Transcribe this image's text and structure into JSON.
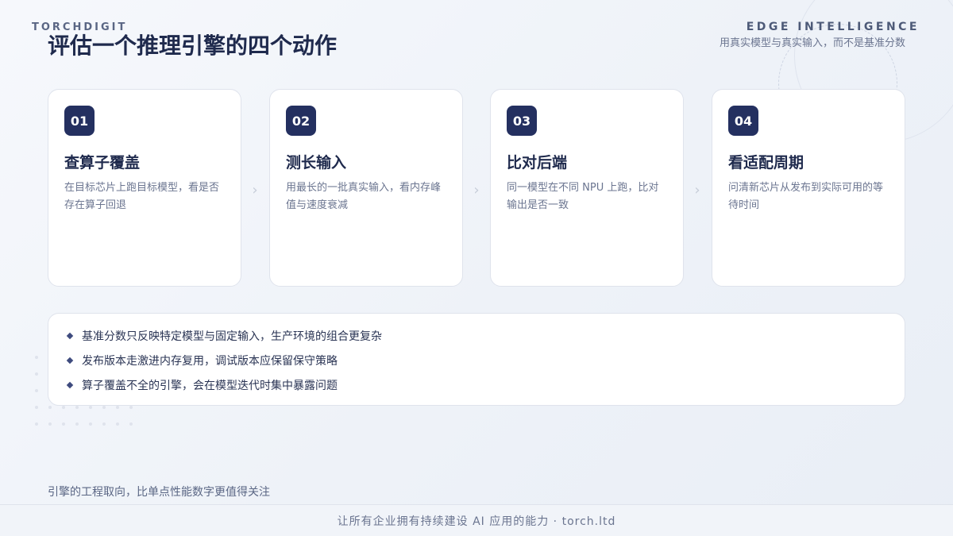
{
  "header": {
    "brand": "TORCHDIGIT",
    "title": "评估一个推理引擎的四个动作",
    "topic": "EDGE INTELLIGENCE",
    "subtitle": "用真实模型与真实输入，而不是基准分数"
  },
  "steps": [
    {
      "number": "01",
      "title": "查算子覆盖",
      "desc": "在目标芯片上跑目标模型，看是否存在算子回退"
    },
    {
      "number": "02",
      "title": "测长输入",
      "desc": "用最长的一批真实输入，看内存峰值与速度衰减"
    },
    {
      "number": "03",
      "title": "比对后端",
      "desc": "同一模型在不同 NPU 上跑，比对输出是否一致"
    },
    {
      "number": "04",
      "title": "看适配周期",
      "desc": "问清新芯片从发布到实际可用的等待时间"
    }
  ],
  "arrow_glyph": "›",
  "notes": [
    "基准分数只反映特定模型与固定输入，生产环境的组合更复杂",
    "发布版本走激进内存复用，调试版本应保留保守策略",
    "算子覆盖不全的引擎，会在模型迭代时集中暴露问题"
  ],
  "footer": {
    "note": "引擎的工程取向，比单点性能数字更值得关注",
    "tagline": "让所有企业拥有持续建设 AI 应用的能力 · torch.ltd"
  },
  "colors": {
    "accent": "#243060",
    "background": "#f1f4f9",
    "card_border": "#dfe3ec",
    "muted_text": "#6b7590"
  }
}
